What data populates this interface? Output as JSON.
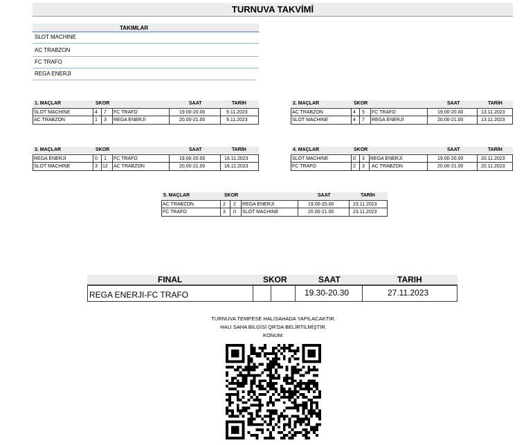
{
  "title": "TURNUVA TAKVİMİ",
  "teams": {
    "header": "TAKIMLAR",
    "items": [
      "SLOT  MACHINE",
      "AC TRABZON",
      "FC TRAFO",
      "REGA  ENERJİ"
    ]
  },
  "headers": {
    "macth_skor": "SKOR",
    "saat": "SAAT",
    "tarih": "TARİH"
  },
  "rounds": [
    {
      "label": "1. MAÇLAR",
      "matches": [
        {
          "home": "SLOT MACHINE",
          "hs": "4",
          "as": "7",
          "away": "FC TRAFO",
          "saat": "19.00-20.00",
          "tarih": "9.11.2023"
        },
        {
          "home": "AC TRABZON",
          "hs": "1",
          "as": "3",
          "away": "REGA ENERJİ",
          "saat": "20.00-21.00",
          "tarih": "9.11.2023"
        }
      ]
    },
    {
      "label": "2. MAÇLAR",
      "matches": [
        {
          "home": "AC TRABZON",
          "hs": "4",
          "as": "5",
          "away": "FC TRAFO",
          "saat": "19.00-20.00",
          "tarih": "13.11.2023"
        },
        {
          "home": "SLOT MACHINE",
          "hs": "4",
          "as": "7",
          "away": "REGA ENERJİ",
          "saat": "20.00-21.00",
          "tarih": "13.11.2023"
        }
      ]
    },
    {
      "label": "3. MAÇLAR",
      "matches": [
        {
          "home": "REGA ENERJİ",
          "hs": "0",
          "as": "1",
          "away": "FC TRAFO",
          "saat": "19.00-20.00",
          "tarih": "16.11.2023"
        },
        {
          "home": "SLOT MACHINE",
          "hs": "3",
          "as": "12",
          "away": "AC TRABZON",
          "saat": "20.00-21.00",
          "tarih": "16.11.2023"
        }
      ]
    },
    {
      "label": "4. MAÇLAR",
      "matches": [
        {
          "home": "SLOT  MACHINE",
          "hs": "0",
          "as": "3",
          "away": "REGA ENERJİ",
          "saat": "19.00-20.00",
          "tarih": "20.11.2023"
        },
        {
          "home": "FC TRAFO",
          "hs": "2",
          "as": "3",
          "away": "AC TRABZON",
          "saat": "20.00-21.00",
          "tarih": "20.11.2023"
        }
      ]
    },
    {
      "label": "5. MAÇLAR",
      "matches": [
        {
          "home": "AC TRABZON",
          "hs": "2",
          "as": "2",
          "away": "REGA ENERJİ",
          "saat": "19.00-20.00",
          "tarih": "23.11.2023"
        },
        {
          "home": "FC TRAFO",
          "hs": "3",
          "as": "0",
          "away": "SLOT MACHINE",
          "saat": "20.00-21.00",
          "tarih": "23.11.2023"
        }
      ]
    }
  ],
  "final": {
    "label": "FINAL",
    "skor": "SKOR",
    "saat_label": "SAAT",
    "tarih_label": "TARIH",
    "match": "REGA ENERJI-FC TRAFO",
    "saat": "19.30-20.30",
    "tarih": "27.11.2023"
  },
  "notes": [
    "TURNUVA TEMPESE HALISAHADA YAPILACAKTIR.",
    "HALI SAHA BİLGİSİ QR'DA BELİRTİLMİŞTİR.",
    "KONUM:"
  ],
  "qr": {
    "icon": "qr-code-icon"
  }
}
